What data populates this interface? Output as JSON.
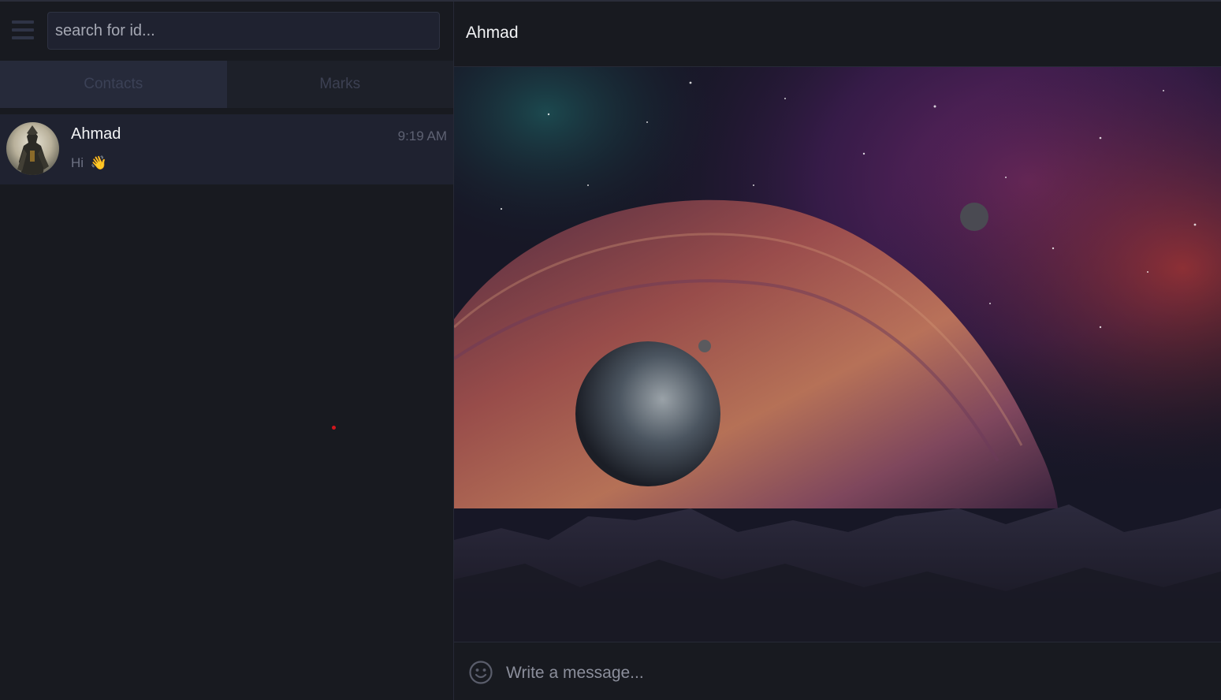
{
  "sidebar": {
    "search": {
      "placeholder": "search for id..."
    },
    "tabs": [
      {
        "label": "Contacts",
        "active": true
      },
      {
        "label": "Marks",
        "active": false
      }
    ],
    "contacts": [
      {
        "name": "Ahmad",
        "time": "9:19 AM",
        "last_message": "Hi",
        "emoji": "👋"
      }
    ]
  },
  "chat": {
    "title": "Ahmad",
    "composer": {
      "placeholder": "Write a message..."
    }
  },
  "colors": {
    "background": "#181a20",
    "panel": "#1f2230",
    "accent_dot": "#d0161c"
  },
  "icons": [
    "menu-icon",
    "emoji-icon"
  ]
}
